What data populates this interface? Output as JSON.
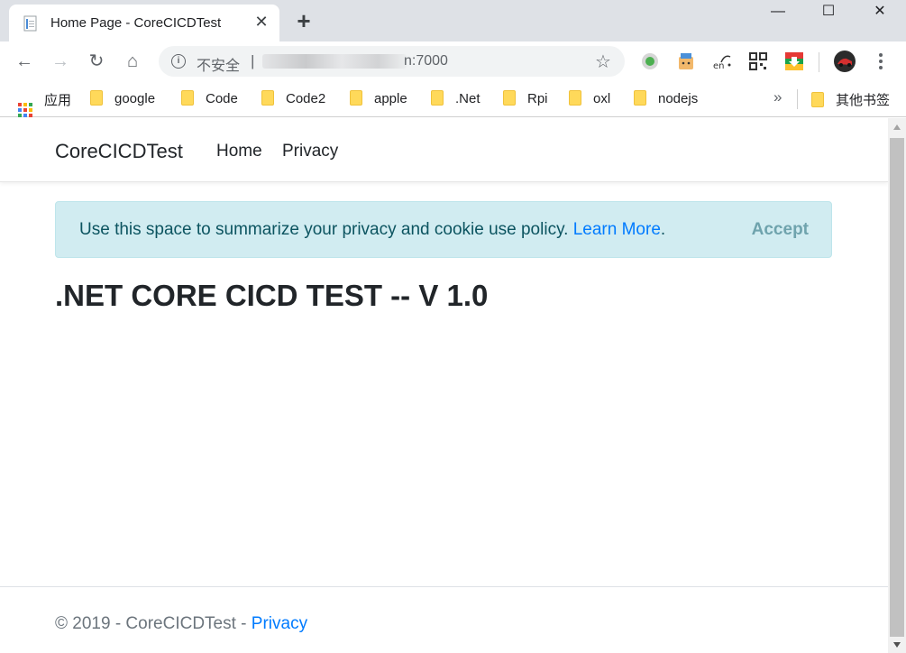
{
  "browser": {
    "tab_title": "Home Page - CoreCICDTest",
    "tab_close": "✕",
    "new_tab": "+",
    "window": {
      "minimize": "—",
      "maximize": "☐",
      "close": "✕"
    },
    "nav": {
      "back": "←",
      "forward": "→",
      "reload": "↻",
      "home": "⌂"
    },
    "address": {
      "security_label": "不安全",
      "separator": "|",
      "url_visible_end": "n:7000"
    },
    "bookmark_star": "☆",
    "extensions": [
      "record-icon",
      "translate-face-icon",
      "en-dictionary-icon",
      "qr-code-icon",
      "shield-download-icon",
      "avatar"
    ],
    "bookmarks": [
      {
        "label": "应用",
        "type": "apps"
      },
      {
        "label": "google",
        "type": "folder"
      },
      {
        "label": "Code",
        "type": "folder"
      },
      {
        "label": "Code2",
        "type": "folder"
      },
      {
        "label": "apple",
        "type": "folder"
      },
      {
        "label": ".Net",
        "type": "folder"
      },
      {
        "label": "Rpi",
        "type": "folder"
      },
      {
        "label": "oxl",
        "type": "folder"
      },
      {
        "label": "nodejs",
        "type": "folder"
      }
    ],
    "bookmarks_more": "»",
    "other_bookmarks": "其他书签"
  },
  "site": {
    "brand": "CoreCICDTest",
    "nav_links": [
      "Home",
      "Privacy"
    ],
    "cookie_alert": {
      "message": "Use this space to summarize your privacy and cookie use policy. ",
      "link": "Learn More",
      "trailing": ".",
      "accept": "Accept"
    },
    "heading": ".NET CORE CICD TEST -- V 1.0",
    "footer": {
      "text": "© 2019 - CoreCICDTest - ",
      "link": "Privacy"
    }
  },
  "colors": {
    "alert_bg": "#d1ecf1",
    "alert_text": "#0c5460",
    "link": "#007bff",
    "muted": "#6c757d"
  }
}
